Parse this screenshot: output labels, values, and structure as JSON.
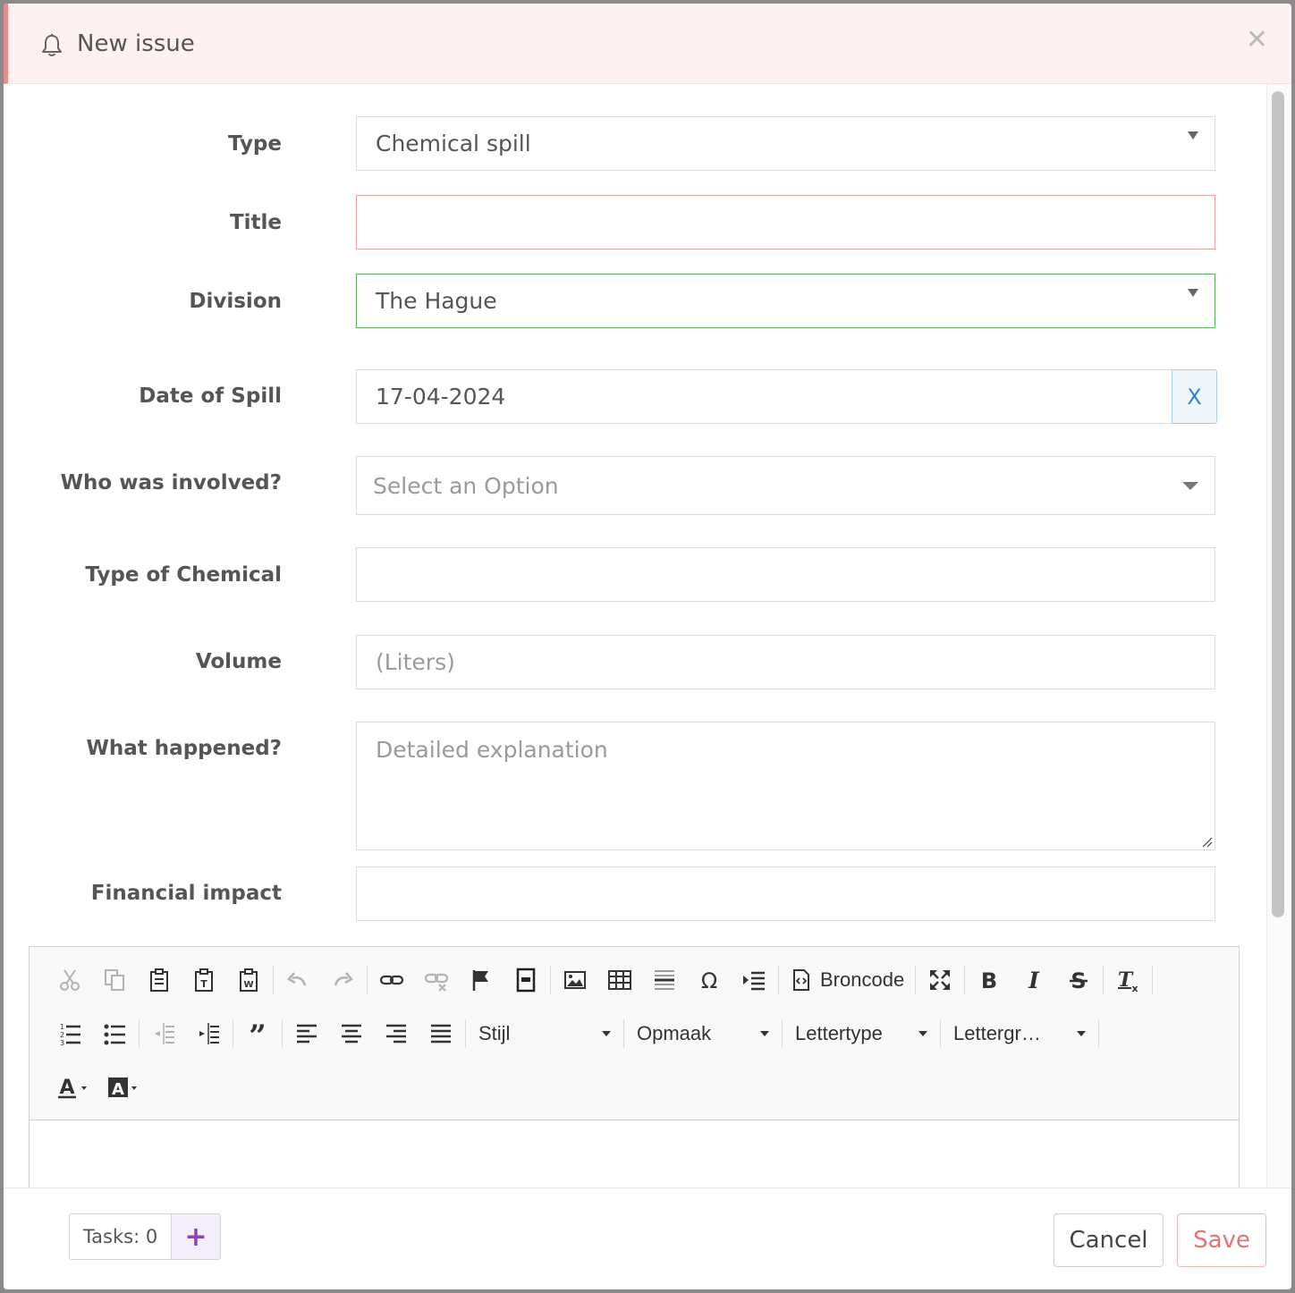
{
  "header": {
    "title": "New issue"
  },
  "form": {
    "type": {
      "label": "Type",
      "value": "Chemical spill"
    },
    "title": {
      "label": "Title",
      "value": ""
    },
    "division": {
      "label": "Division",
      "value": "The Hague"
    },
    "date_of_spill": {
      "label": "Date of Spill",
      "value": "17-04-2024",
      "clear_label": "X"
    },
    "who_involved": {
      "label": "Who was involved?",
      "placeholder": "Select an Option"
    },
    "type_of_chemical": {
      "label": "Type of Chemical",
      "value": ""
    },
    "volume": {
      "label": "Volume",
      "placeholder": "(Liters)"
    },
    "what_happened": {
      "label": "What happened?",
      "placeholder": "Detailed explanation"
    },
    "financial_impact": {
      "label": "Financial impact",
      "value": ""
    }
  },
  "editor": {
    "source_label": "Broncode",
    "style_combo": "Stijl",
    "format_combo": "Opmaak",
    "font_combo": "Lettertype",
    "size_combo": "Lettergr…"
  },
  "footer": {
    "tasks_label": "Tasks: 0",
    "tasks_add": "+",
    "cancel": "Cancel",
    "save": "Save"
  },
  "colors": {
    "header_bg": "#fdf1f1",
    "error_border": "#e88b8b",
    "valid_border": "#5cb85c",
    "accent_purple": "#8e44ad",
    "save_text": "#e57373"
  }
}
